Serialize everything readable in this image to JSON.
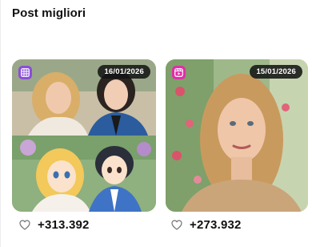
{
  "section": {
    "title": "Post migliori"
  },
  "posts": [
    {
      "type_icon": "carousel-grid-icon",
      "date": "16/01/2026",
      "likes": "+313.392",
      "like_icon": "heart-outline-icon",
      "badge_color": "#8a4fd8"
    },
    {
      "type_icon": "reel-play-icon",
      "date": "15/01/2026",
      "likes": "+273.932",
      "like_icon": "heart-outline-icon",
      "badge_color": "#e02fa7"
    }
  ]
}
